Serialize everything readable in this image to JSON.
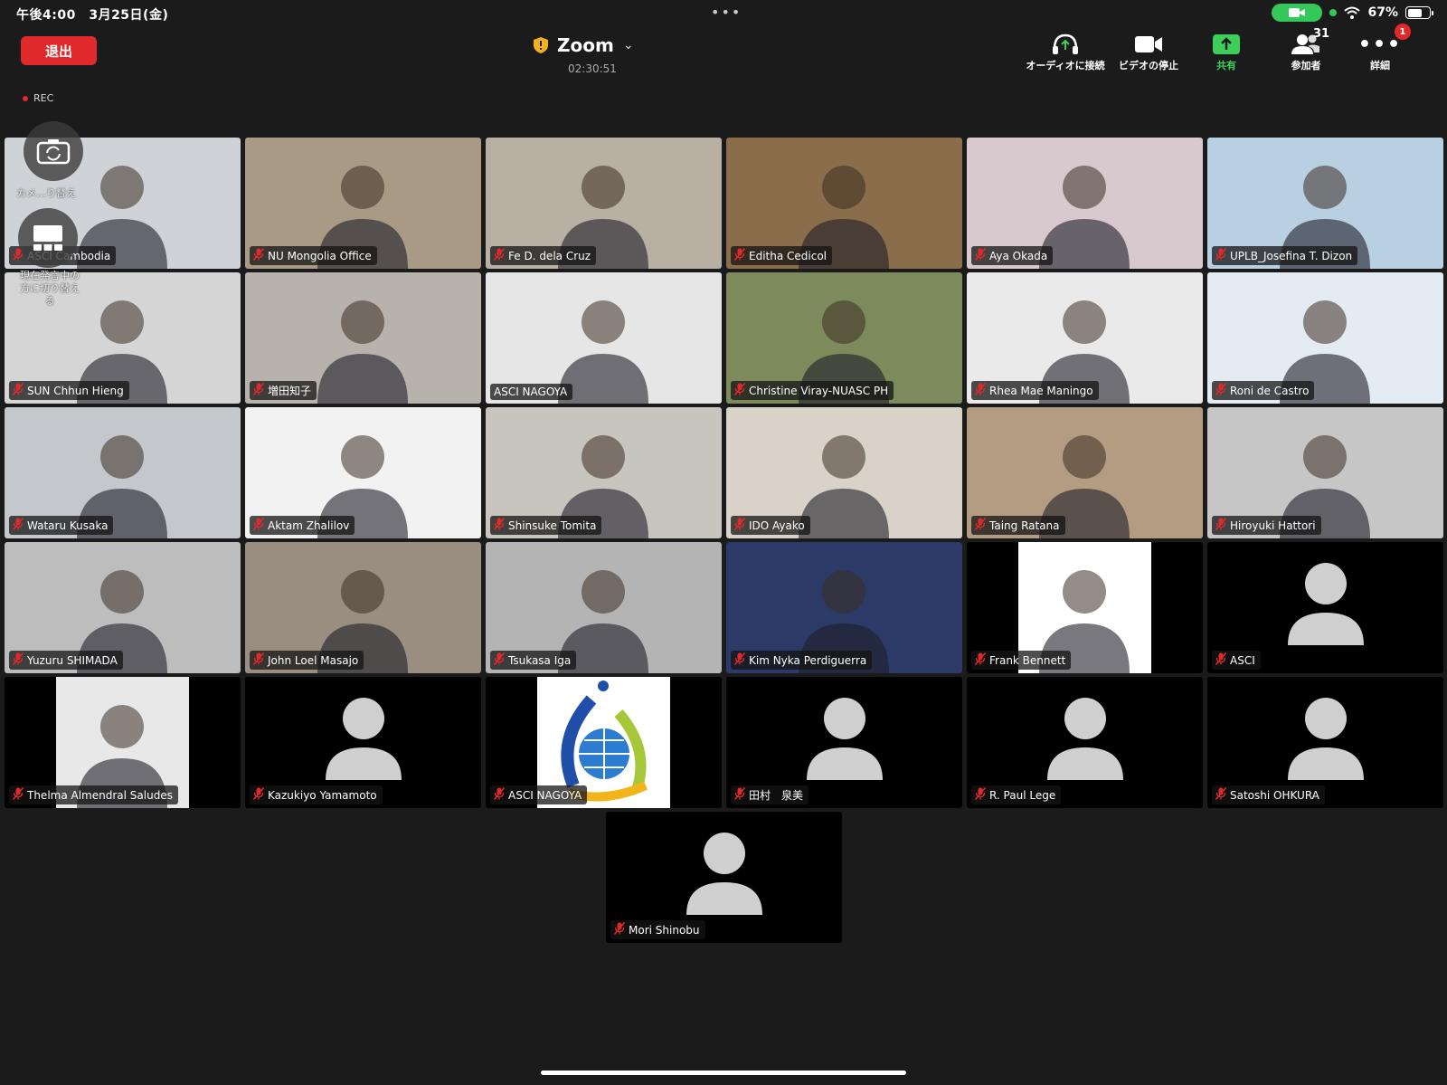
{
  "status": {
    "time": "午後4:00　3月25日(金)",
    "battery": "67%",
    "battery_level": 0.67
  },
  "header": {
    "leave_label": "退出",
    "title": "Zoom",
    "timer": "02:30:51",
    "rec_label": "REC"
  },
  "toolbar": {
    "audio_label": "オーディオに接続",
    "video_label": "ビデオの停止",
    "share_label": "共有",
    "participants_label": "参加者",
    "participants_count": "31",
    "more_label": "詳細",
    "more_badge": "1"
  },
  "overlays": {
    "camera_switch_label": "カメ…り替え",
    "speaker_switch_label": "現在発言中の方に切り替える"
  },
  "participants": [
    {
      "name": "ASCI Cambodia",
      "video": true,
      "bg": "#cfd3d8"
    },
    {
      "name": "NU Mongolia Office",
      "video": true,
      "bg": "#a99a86"
    },
    {
      "name": "Fe D. dela Cruz",
      "video": true,
      "bg": "#b8b0a2"
    },
    {
      "name": "Editha Cedicol",
      "video": true,
      "bg": "#8a6d4a"
    },
    {
      "name": "Aya Okada",
      "video": true,
      "bg": "#d8c9cf"
    },
    {
      "name": "UPLB_Josefina T. Dizon",
      "video": true,
      "bg": "#b9cfe2"
    },
    {
      "name": "SUN Chhun Hieng",
      "video": true,
      "bg": "#d5d5d5"
    },
    {
      "name": "増田知子",
      "video": true,
      "bg": "#b8b2ad"
    },
    {
      "name": "ASCI NAGOYA",
      "video": true,
      "bg": "#e6e6e6",
      "active": true
    },
    {
      "name": "Christine Viray-NUASC PH",
      "video": true,
      "bg": "#7d8a5c"
    },
    {
      "name": "Rhea Mae Maningo",
      "video": true,
      "bg": "#eaeaea"
    },
    {
      "name": "Roni de Castro",
      "video": true,
      "bg": "#e4ecf3"
    },
    {
      "name": "Wataru Kusaka",
      "video": true,
      "bg": "#c4c8cc"
    },
    {
      "name": "Aktam Zhalilov",
      "video": true,
      "bg": "#f2f2f2"
    },
    {
      "name": "Shinsuke Tomita",
      "video": true,
      "bg": "#c8c4be"
    },
    {
      "name": "IDO Ayako",
      "video": true,
      "bg": "#d9d2c8"
    },
    {
      "name": "Taing Ratana",
      "video": true,
      "bg": "#b39c82"
    },
    {
      "name": "Hiroyuki Hattori",
      "video": true,
      "bg": "#c6c6c6"
    },
    {
      "name": "Yuzuru SHIMADA",
      "video": true,
      "bg": "#bdbdbd"
    },
    {
      "name": "John Loel Masajo",
      "video": true,
      "bg": "#9a8e80"
    },
    {
      "name": "Tsukasa Iga",
      "video": true,
      "bg": "#b4b4b4"
    },
    {
      "name": "Kim Nyka Perdiguerra",
      "video": true,
      "bg": "#2b3a66"
    },
    {
      "name": "Frank Bennett",
      "video": true,
      "bg": "#ffffff",
      "narrow": true
    },
    {
      "name": "ASCI",
      "video": false
    },
    {
      "name": "Thelma Almendral Saludes",
      "video": true,
      "bg": "#e8e8e8",
      "narrow": true
    },
    {
      "name": "Kazukiyo Yamamoto",
      "video": false
    },
    {
      "name": "ASCI NAGOYA",
      "video": true,
      "bg": "#ffffff",
      "narrow": true,
      "logo": true
    },
    {
      "name": "田村　泉美",
      "video": false
    },
    {
      "name": "R. Paul Lege",
      "video": false
    },
    {
      "name": "Satoshi OHKURA",
      "video": false
    },
    {
      "name": "Mori Shinobu",
      "video": false
    }
  ]
}
